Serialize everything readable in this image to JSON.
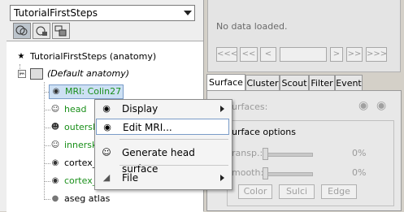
{
  "protocol_select": {
    "value": "TutorialFirstSteps"
  },
  "tree": {
    "root": "TutorialFirstSteps (anatomy)",
    "subject": "(Default anatomy)",
    "items": [
      "MRI: Colin27",
      "head",
      "outersk",
      "innersk",
      "cortex_",
      "cortex_",
      "aseg atlas"
    ]
  },
  "context_menu": {
    "items": [
      "Display",
      "Edit MRI...",
      "Generate head surface",
      "File"
    ]
  },
  "viewer": {
    "status": "No data loaded.",
    "nav": [
      "<<<",
      "<<",
      "<",
      ">",
      ">>",
      ">>>"
    ]
  },
  "tabs": [
    "Surface",
    "Cluster",
    "Scout",
    "Filter",
    "Event"
  ],
  "surface_panel": {
    "surfaces_label": "urfaces:",
    "options_title": "urface options",
    "transp_label": "ransp.:",
    "transp_value": "0%",
    "smooth_label": "mooth:",
    "smooth_value": "0%",
    "buttons": [
      "Color",
      "Sulci",
      "Edge"
    ]
  },
  "colors": {
    "green_text": "#1a8f1a",
    "highlight": "#7a9cc8"
  }
}
